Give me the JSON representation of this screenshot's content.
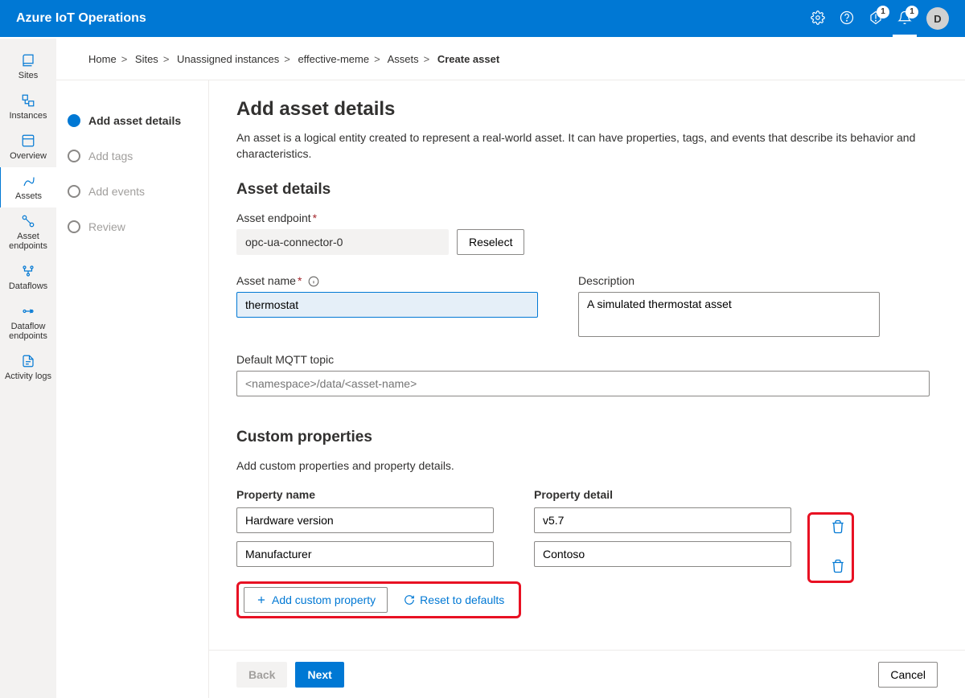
{
  "brand": "Azure IoT Operations",
  "header": {
    "badge1": "1",
    "badge2": "1",
    "avatar": "D"
  },
  "sidebar": {
    "items": [
      {
        "label": "Sites"
      },
      {
        "label": "Instances"
      },
      {
        "label": "Overview"
      },
      {
        "label": "Assets"
      },
      {
        "label": "Asset endpoints"
      },
      {
        "label": "Dataflows"
      },
      {
        "label": "Dataflow endpoints"
      },
      {
        "label": "Activity logs"
      }
    ]
  },
  "breadcrumb": {
    "items": [
      "Home",
      "Sites",
      "Unassigned instances",
      "effective-meme",
      "Assets"
    ],
    "current": "Create asset"
  },
  "wizard": {
    "steps": [
      {
        "label": "Add asset details"
      },
      {
        "label": "Add tags"
      },
      {
        "label": "Add events"
      },
      {
        "label": "Review"
      }
    ]
  },
  "page": {
    "title": "Add asset details",
    "intro": "An asset is a logical entity created to represent a real-world asset. It can have properties, tags, and events that describe its behavior and characteristics.",
    "section_details": "Asset details",
    "endpoint_label": "Asset endpoint",
    "endpoint_value": "opc-ua-connector-0",
    "reselect": "Reselect",
    "assetname_label": "Asset name",
    "assetname_value": "thermostat",
    "description_label": "Description",
    "description_value": "A simulated thermostat asset",
    "mqtt_label": "Default MQTT topic",
    "mqtt_placeholder": "<namespace>/data/<asset-name>",
    "section_custom": "Custom properties",
    "custom_intro": "Add custom properties and property details.",
    "col_name": "Property name",
    "col_detail": "Property detail",
    "rows": [
      {
        "name": "Hardware version",
        "detail": "v5.7"
      },
      {
        "name": "Manufacturer",
        "detail": "Contoso"
      }
    ],
    "add_custom": "Add custom property",
    "reset_defaults": "Reset to defaults"
  },
  "footer": {
    "back": "Back",
    "next": "Next",
    "cancel": "Cancel"
  }
}
